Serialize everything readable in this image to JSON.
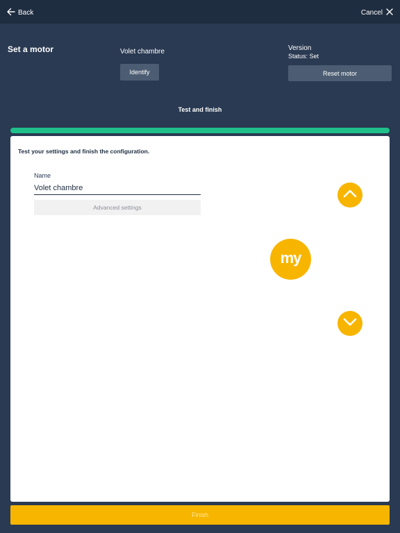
{
  "topbar": {
    "back_label": "Back",
    "cancel_label": "Cancel"
  },
  "header": {
    "title": "Set a motor",
    "motor_name": "Volet chambre",
    "identify_label": "Identify",
    "version_label": "Version",
    "status_label": "Status: Set",
    "reset_label": "Reset motor"
  },
  "step": {
    "title": "Test and finish",
    "progress": 1.0
  },
  "card": {
    "instruction": "Test your settings and finish the configuration.",
    "name_label": "Name",
    "name_value": "Volet chambre",
    "advanced_label": "Advanced settings",
    "my_label": "my"
  },
  "footer": {
    "finish_label": "Finish"
  },
  "icons": {
    "back": "arrow-left-icon",
    "cancel": "close-icon",
    "up": "chevron-up-icon",
    "down": "chevron-down-icon"
  },
  "colors": {
    "background": "#2a3a52",
    "topbar": "#1f2d40",
    "progress": "#1fc08a",
    "accent": "#f7b500",
    "button": "#4c5d73"
  }
}
